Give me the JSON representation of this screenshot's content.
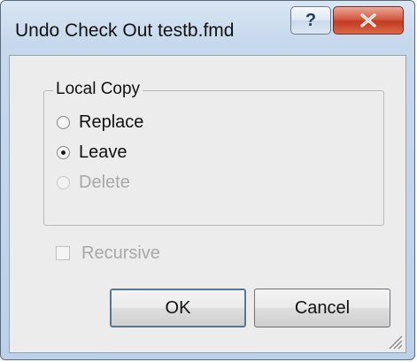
{
  "window": {
    "title": "Undo Check Out testb.fmd",
    "help_symbol": "?",
    "close_symbol": "X"
  },
  "group": {
    "legend": "Local Copy",
    "options": [
      {
        "label": "Replace",
        "checked": false,
        "enabled": true
      },
      {
        "label": "Leave",
        "checked": true,
        "enabled": true
      },
      {
        "label": "Delete",
        "checked": false,
        "enabled": false
      }
    ]
  },
  "recursive": {
    "label": "Recursive",
    "checked": false,
    "enabled": false
  },
  "buttons": {
    "ok": "OK",
    "cancel": "Cancel"
  },
  "colors": {
    "frame": "#bcd1e8",
    "client": "#ececec",
    "close_button": "#c23a20",
    "disabled_text": "#a8a8a8"
  }
}
